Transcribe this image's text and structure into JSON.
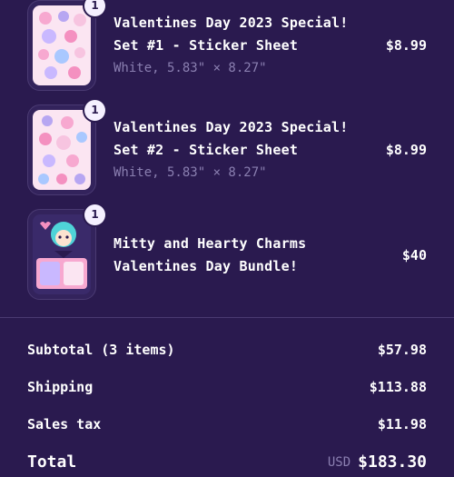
{
  "cart": {
    "items": [
      {
        "quantity": "1",
        "title_line1": "Valentines Day 2023 Special!",
        "title_line2": "Set #1 - Sticker Sheet",
        "variant": "White, 5.83\" × 8.27\"",
        "price": "$8.99",
        "image_icon": "sticker-sheet-image"
      },
      {
        "quantity": "1",
        "title_line1": "Valentines Day 2023 Special!",
        "title_line2": "Set #2 - Sticker Sheet",
        "variant": "White, 5.83\" × 8.27\"",
        "price": "$8.99",
        "image_icon": "sticker-sheet-image"
      },
      {
        "quantity": "1",
        "title_line1": "Mitty and Hearty Charms",
        "title_line2": "Valentines Day Bundle!",
        "price": "$40",
        "image_icon": "charm-bundle-image"
      }
    ]
  },
  "summary": {
    "subtotal_label": "Subtotal (3 items)",
    "subtotal_value": "$57.98",
    "shipping_label": "Shipping",
    "shipping_value": "$113.88",
    "tax_label": "Sales tax",
    "tax_value": "$11.98",
    "total_label": "Total",
    "currency": "USD",
    "total_value": "$183.30"
  },
  "colors": {
    "background": "#2a1a4f",
    "muted_text": "#8a7fb0",
    "divider": "#4a3a72",
    "badge": "#f5f0ff"
  }
}
